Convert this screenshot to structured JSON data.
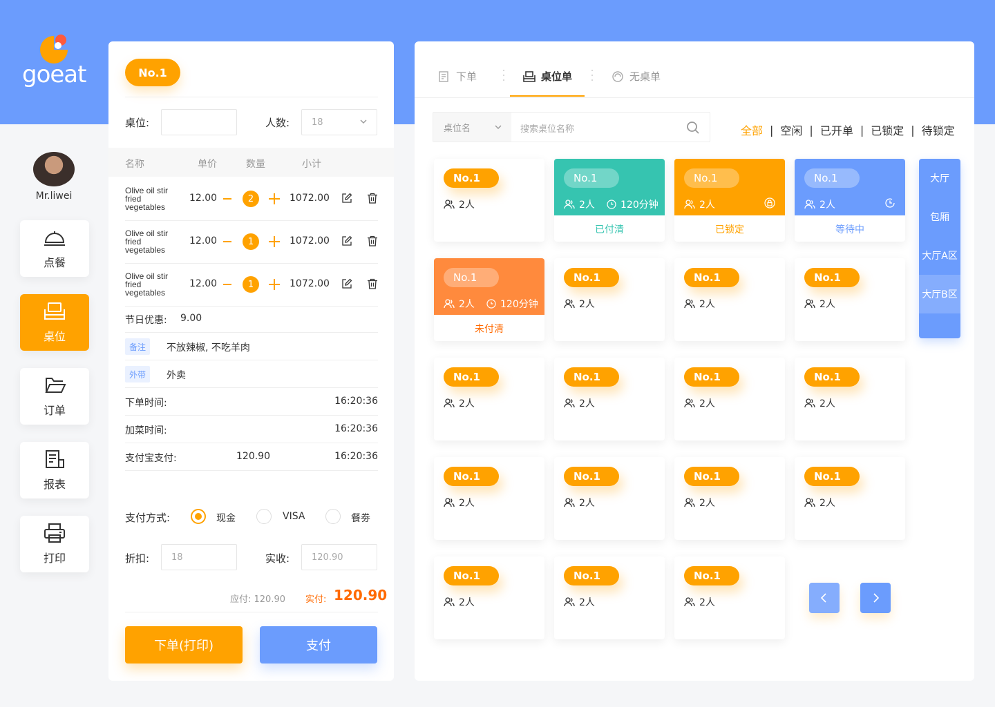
{
  "brand": {
    "logo_text": "goeat",
    "primary": "#ffa200",
    "blue": "#6b9cfd",
    "teal": "#36c4b0",
    "coral": "#ff8a3d"
  },
  "user": {
    "name": "Mr.liwei"
  },
  "nav": [
    {
      "label": "点餐",
      "icon": "bell-icon",
      "active": false
    },
    {
      "label": "桌位",
      "icon": "table-icon",
      "active": true
    },
    {
      "label": "订单",
      "icon": "folder-icon",
      "active": false
    },
    {
      "label": "报表",
      "icon": "report-icon",
      "active": false
    },
    {
      "label": "打印",
      "icon": "printer-icon",
      "active": false
    }
  ],
  "order": {
    "table_badge": "No.1",
    "table_label": "桌位:",
    "table_value": "",
    "people_label": "人数:",
    "people_value": "18",
    "columns": {
      "name": "名称",
      "price": "单价",
      "qty": "数量",
      "subtotal": "小计"
    },
    "items": [
      {
        "name": "Olive oil stir fried vegetables",
        "price": "12.00",
        "qty": "2",
        "subtotal": "1072.00"
      },
      {
        "name": "Olive oil stir fried vegetables",
        "price": "12.00",
        "qty": "1",
        "subtotal": "1072.00"
      },
      {
        "name": "Olive oil stir fried vegetables",
        "price": "12.00",
        "qty": "1",
        "subtotal": "1072.00"
      }
    ],
    "discount_label": "节日优惠:",
    "discount_value": "9.00",
    "note_tag": "备注",
    "note_value": "不放辣椒, 不吃羊肉",
    "takeout_tag": "外带",
    "takeout_value": "外卖",
    "order_time_label": "下单时间:",
    "order_time": "16:20:36",
    "add_time_label": "加菜时间:",
    "add_time": "16:20:36",
    "alipay_label": "支付宝支付:",
    "alipay_amount": "120.90",
    "alipay_time": "16:20:36",
    "pay_method_label": "支付方式:",
    "pay_methods": [
      {
        "label": "现金",
        "selected": true
      },
      {
        "label": "VISA",
        "selected": false
      },
      {
        "label": "餐劵",
        "selected": false
      }
    ],
    "discount_field_label": "折扣:",
    "discount_field_placeholder": "18",
    "received_label": "实收:",
    "received_placeholder": "120.90",
    "due_text": "应付: 120.90",
    "paid_label": "实付:",
    "paid_value": "120.90",
    "order_button": "下单(打印)",
    "pay_button": "支付"
  },
  "tables": {
    "tabs": [
      {
        "label": "下单",
        "icon": "order-form-icon",
        "active": false
      },
      {
        "label": "桌位单",
        "icon": "seat-icon",
        "active": true
      },
      {
        "label": "无桌单",
        "icon": "circle-dashed-icon",
        "active": false
      }
    ],
    "search_select": "桌位名",
    "search_placeholder": "搜索桌位名称",
    "filters": [
      {
        "label": "全部",
        "active": true
      },
      {
        "label": "空闲",
        "active": false
      },
      {
        "label": "已开单",
        "active": false
      },
      {
        "label": "已锁定",
        "active": false
      },
      {
        "label": "待锁定",
        "active": false
      }
    ],
    "areas": [
      {
        "label": "大厅",
        "selected": false
      },
      {
        "label": "包厢",
        "selected": false
      },
      {
        "label": "大厅A区",
        "selected": false
      },
      {
        "label": "大厅B区",
        "selected": true
      }
    ],
    "cards": [
      {
        "name": "No.1",
        "people": "2人",
        "kind": "plain"
      },
      {
        "name": "No.1",
        "people": "2人",
        "kind": "paid",
        "time": "120分钟",
        "status": "已付清"
      },
      {
        "name": "No.1",
        "people": "2人",
        "kind": "locked",
        "status": "已锁定"
      },
      {
        "name": "No.1",
        "people": "2人",
        "kind": "waiting",
        "status": "等待中"
      },
      {
        "name": "No.1",
        "people": "2人",
        "kind": "unpaid",
        "time": "120分钟",
        "status": "未付清"
      },
      {
        "name": "No.1",
        "people": "2人",
        "kind": "plain"
      },
      {
        "name": "No.1",
        "people": "2人",
        "kind": "plain"
      },
      {
        "name": "No.1",
        "people": "2人",
        "kind": "plain"
      },
      {
        "name": "No.1",
        "people": "2人",
        "kind": "plain"
      },
      {
        "name": "No.1",
        "people": "2人",
        "kind": "plain"
      },
      {
        "name": "No.1",
        "people": "2人",
        "kind": "plain"
      },
      {
        "name": "No.1",
        "people": "2人",
        "kind": "plain"
      },
      {
        "name": "No.1",
        "people": "2人",
        "kind": "plain"
      },
      {
        "name": "No.1",
        "people": "2人",
        "kind": "plain"
      },
      {
        "name": "No.1",
        "people": "2人",
        "kind": "plain"
      },
      {
        "name": "No.1",
        "people": "2人",
        "kind": "plain"
      },
      {
        "name": "No.1",
        "people": "2人",
        "kind": "plain"
      },
      {
        "name": "No.1",
        "people": "2人",
        "kind": "plain"
      },
      {
        "name": "No.1",
        "people": "2人",
        "kind": "plain"
      }
    ],
    "pager": {
      "prev_icon": "chevron-left-icon",
      "next_icon": "chevron-right-icon"
    }
  }
}
